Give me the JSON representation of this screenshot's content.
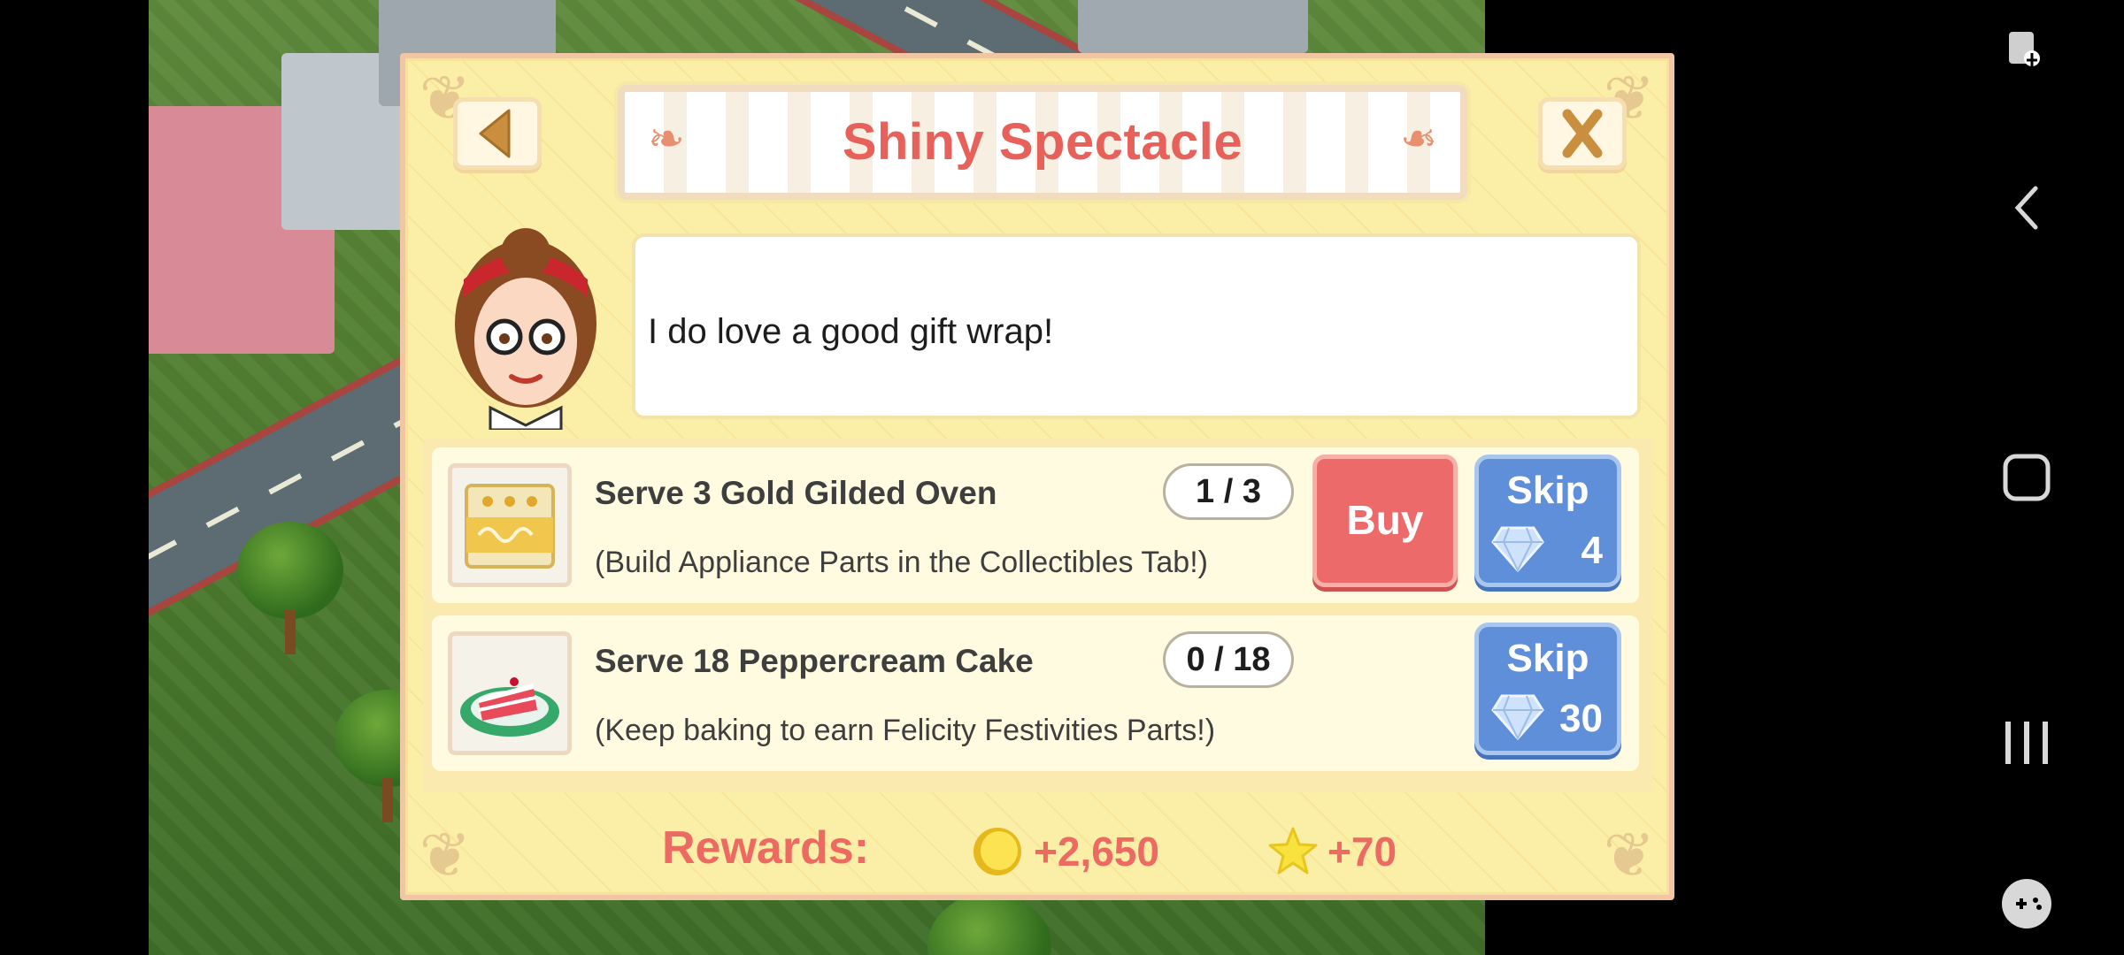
{
  "dialog": {
    "title": "Shiny Spectacle",
    "speech": "I do love a good gift wrap!"
  },
  "tasks": [
    {
      "title": "Serve 3 Gold Gilded Oven",
      "hint": "(Build Appliance Parts in the Collectibles Tab!)",
      "progress": "1 / 3",
      "buy_label": "Buy",
      "skip_label": "Skip",
      "skip_cost": "4",
      "thumb_icon": "gold-oven-icon"
    },
    {
      "title": "Serve 18 Peppercream Cake",
      "hint": "(Keep baking to earn Felicity Festivities Parts!)",
      "progress": "0 / 18",
      "skip_label": "Skip",
      "skip_cost": "30",
      "thumb_icon": "cake-slice-icon"
    }
  ],
  "rewards": {
    "label": "Rewards:",
    "coins": "+2,650",
    "xp": "+70"
  },
  "colors": {
    "title": "#e8605a",
    "buy": "#ed6a6a",
    "skip": "#5f8fd9",
    "panel": "#fbeea7"
  }
}
